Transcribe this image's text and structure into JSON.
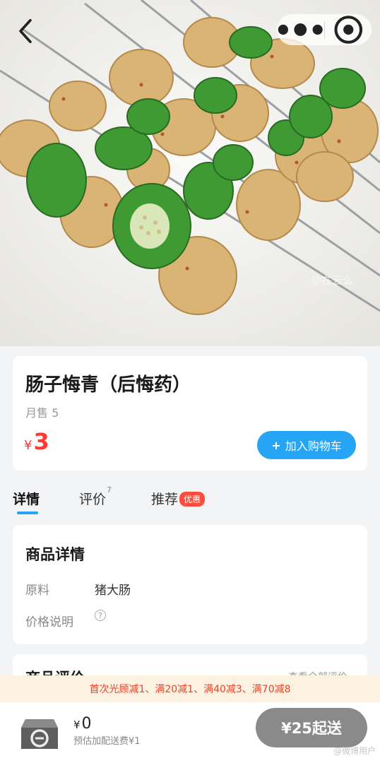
{
  "header": {
    "back_icon": "chevron-left-icon",
    "more_icon": "more-dots-icon",
    "target_icon": "target-circle-icon"
  },
  "product": {
    "name": "肠子悔青（后悔药）",
    "monthly_sales": "月售 5",
    "price_symbol": "¥",
    "price": "3",
    "add_to_cart_icon": "plus-icon",
    "add_to_cart_label": "加入购物车",
    "image_watermark": "@在云么"
  },
  "tabs": [
    {
      "label": "详情",
      "active": true
    },
    {
      "label": "评价",
      "count": "7"
    },
    {
      "label": "推荐",
      "badge": "优惠"
    }
  ],
  "details": {
    "title": "商品详情",
    "rows": [
      {
        "label": "原料",
        "value": "猪大肠"
      },
      {
        "label": "价格说明",
        "icon": "help-circle-icon"
      }
    ]
  },
  "reviews": {
    "title": "商品评价",
    "link": "查看全部评价 ›"
  },
  "promo": {
    "text": "首次光顾减1、满20减1、满40减3、满70减8"
  },
  "cart": {
    "icon": "cart-bag-icon",
    "total_symbol": "¥",
    "total": "0",
    "delivery_note": "预估加配送费¥1",
    "checkout_label": "¥25起送"
  },
  "watermark": "@微博用户",
  "colors": {
    "accent_blue": "#26a4f5",
    "price_red": "#ff3b30",
    "promo_bg": "#fdf1e1",
    "promo_text": "#e8462a",
    "checkout_disabled": "#8a8a8a"
  }
}
